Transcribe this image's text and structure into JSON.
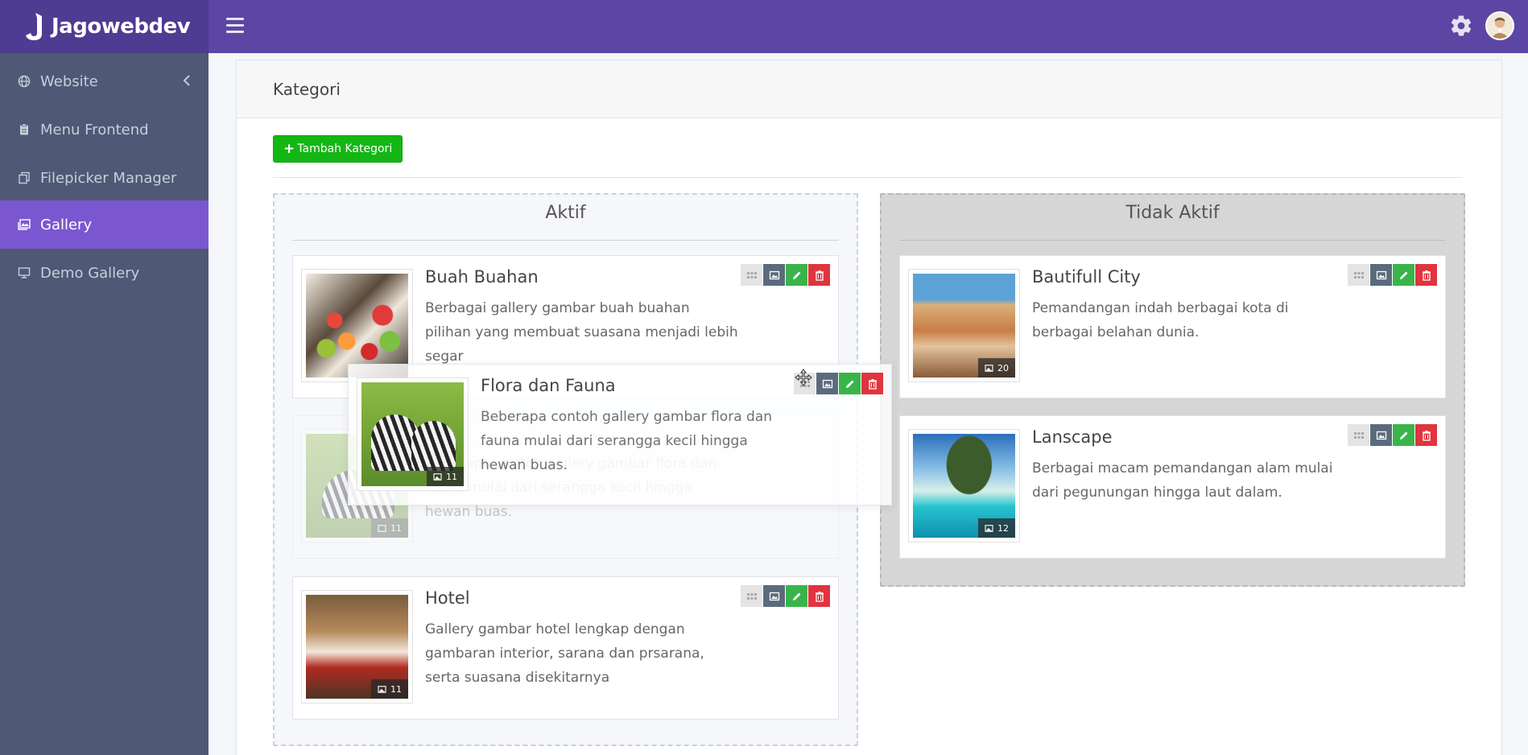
{
  "brand": {
    "name": "Jagowebdev"
  },
  "sidebar": {
    "items": [
      {
        "label": "Website",
        "icon": "globe-icon"
      },
      {
        "label": "Menu Frontend",
        "icon": "clipboard-icon"
      },
      {
        "label": "Filepicker Manager",
        "icon": "copy-icon"
      },
      {
        "label": "Gallery",
        "icon": "gallery-icon"
      },
      {
        "label": "Demo Gallery",
        "icon": "monitor-icon"
      }
    ]
  },
  "page": {
    "title": "Kategori",
    "add_button": "Tambah Kategori"
  },
  "columns": {
    "active": {
      "title": "Aktif"
    },
    "inactive": {
      "title": "Tidak Aktif"
    }
  },
  "categories": {
    "buah": {
      "title": "Buah Buahan",
      "desc": "Berbagai gallery gambar buah buahan pilihan yang membuat suasana menjadi lebih segar"
    },
    "flora": {
      "title": "Flora dan Fauna",
      "desc": "Beberapa contoh gallery gambar flora dan fauna mulai dari serangga kecil hingga hewan buas.",
      "count": "11"
    },
    "hotel": {
      "title": "Hotel",
      "desc": "Gallery gambar hotel lengkap dengan gambaran interior, sarana dan prsarana, serta suasana disekitarnya",
      "count": "11"
    },
    "city": {
      "title": "Bautifull City",
      "desc": "Pemandangan indah berbagai kota di berbagai belahan dunia.",
      "count": "20"
    },
    "lanscape": {
      "title": "Lanscape",
      "desc": "Berbagai macam pemandangan alam mulai dari pegunungan hingga laut dalam.",
      "count": "12"
    }
  },
  "colors": {
    "header": "#5b46a3",
    "sidebar": "#4f5875",
    "sidebar_active": "#7a57d1",
    "add_button": "#14b614",
    "edit": "#39b44a",
    "delete": "#e0343f"
  }
}
